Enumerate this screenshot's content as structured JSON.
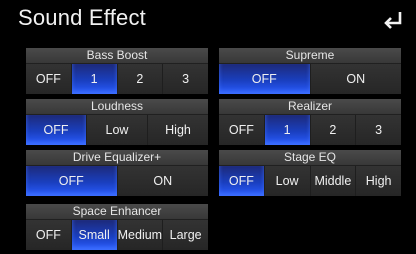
{
  "header": {
    "title": "Sound Effect",
    "back_icon": "back-arrow-icon"
  },
  "groups": {
    "bass_boost": {
      "label": "Bass Boost",
      "options": [
        "OFF",
        "1",
        "2",
        "3"
      ],
      "selected": "1"
    },
    "loudness": {
      "label": "Loudness",
      "options": [
        "OFF",
        "Low",
        "High"
      ],
      "selected": "OFF"
    },
    "drive_equalizer": {
      "label": "Drive Equalizer+",
      "options": [
        "OFF",
        "ON"
      ],
      "selected": "OFF"
    },
    "space_enhancer": {
      "label": "Space Enhancer",
      "options": [
        "OFF",
        "Small",
        "Medium",
        "Large"
      ],
      "selected": "Small"
    },
    "supreme": {
      "label": "Supreme",
      "options": [
        "OFF",
        "ON"
      ],
      "selected": "OFF"
    },
    "realizer": {
      "label": "Realizer",
      "options": [
        "OFF",
        "1",
        "2",
        "3"
      ],
      "selected": "1"
    },
    "stage_eq": {
      "label": "Stage EQ",
      "options": [
        "OFF",
        "Low",
        "Middle",
        "High"
      ],
      "selected": "OFF"
    }
  },
  "colors": {
    "background": "#000000",
    "panel": "#2c2c2c",
    "selected": "#1a3fbf",
    "text": "#f0f0f0"
  }
}
